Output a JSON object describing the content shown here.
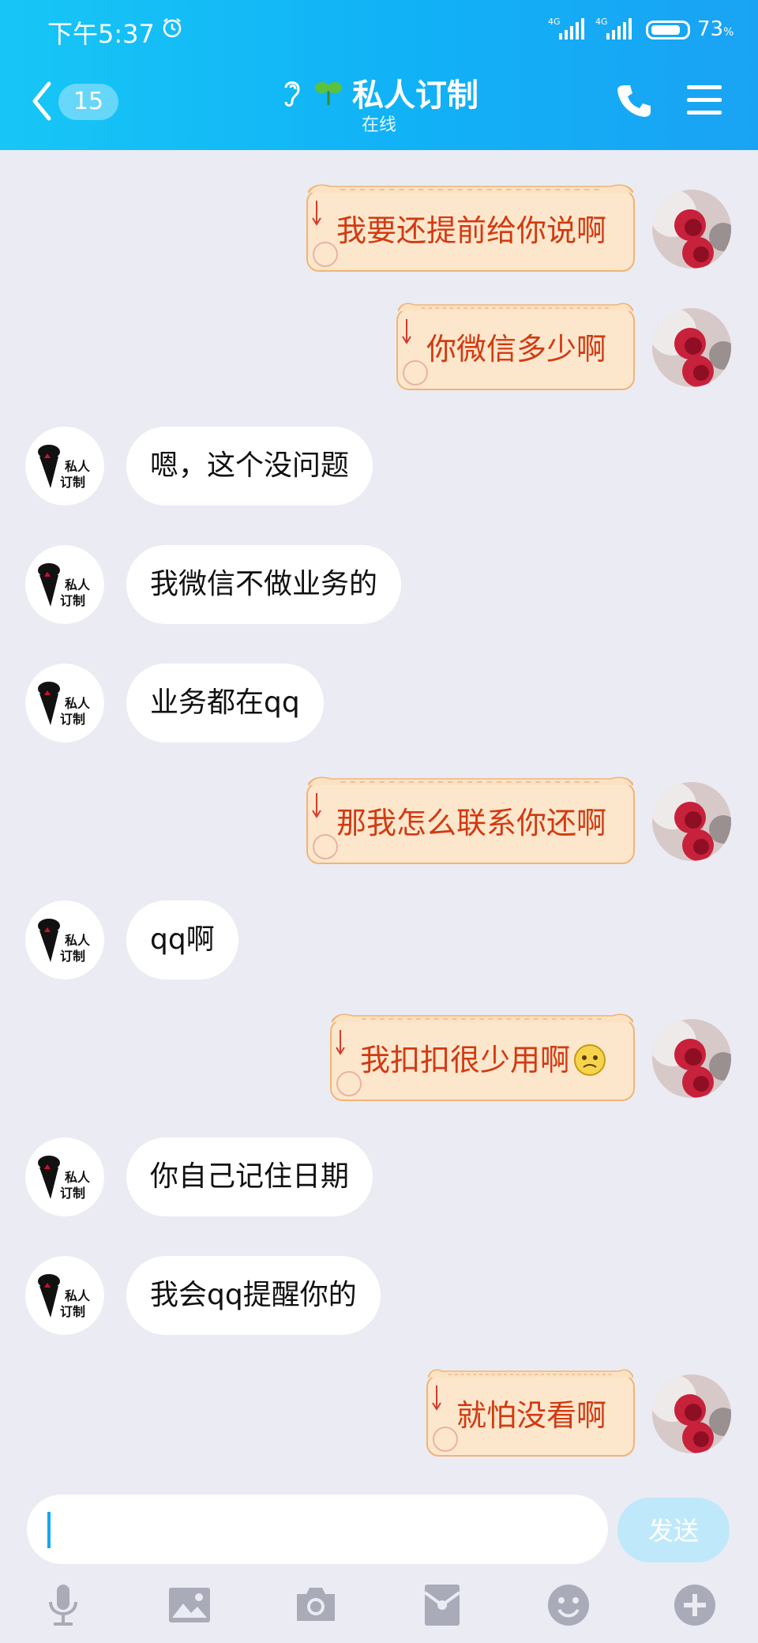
{
  "status": {
    "time": "下午5:37",
    "signal1": "4G",
    "signal2": "4G",
    "battery": "73",
    "battery_unit": "%"
  },
  "header": {
    "unread_count": "15",
    "title": "私人订制",
    "subtitle": "在线"
  },
  "messages": [
    {
      "side": "out",
      "text": "我要还提前给你说啊"
    },
    {
      "side": "out",
      "text": "你微信多少啊"
    },
    {
      "side": "in",
      "text": "嗯，这个没问题"
    },
    {
      "side": "in",
      "text": "我微信不做业务的"
    },
    {
      "side": "in",
      "text": "业务都在qq"
    },
    {
      "side": "out",
      "text": "那我怎么联系你还啊"
    },
    {
      "side": "in",
      "text": "qq啊"
    },
    {
      "side": "out",
      "text": "我扣扣很少用啊"
    },
    {
      "side": "in",
      "text": "你自己记住日期"
    },
    {
      "side": "in",
      "text": "我会qq提醒你的"
    },
    {
      "side": "out",
      "text": "就怕没看啊"
    }
  ],
  "other_avatar_text": [
    "私人",
    "订制"
  ],
  "input": {
    "value": "",
    "placeholder": "",
    "send_label": "发送"
  },
  "colors": {
    "header": "#11b1f6",
    "out_text": "#d23a12",
    "out_bubble": "#fde7cc",
    "background": "#ebebf3"
  },
  "toolbar": [
    "mic-icon",
    "image-icon",
    "camera-icon",
    "red-packet-icon",
    "emoji-icon",
    "plus-icon"
  ]
}
